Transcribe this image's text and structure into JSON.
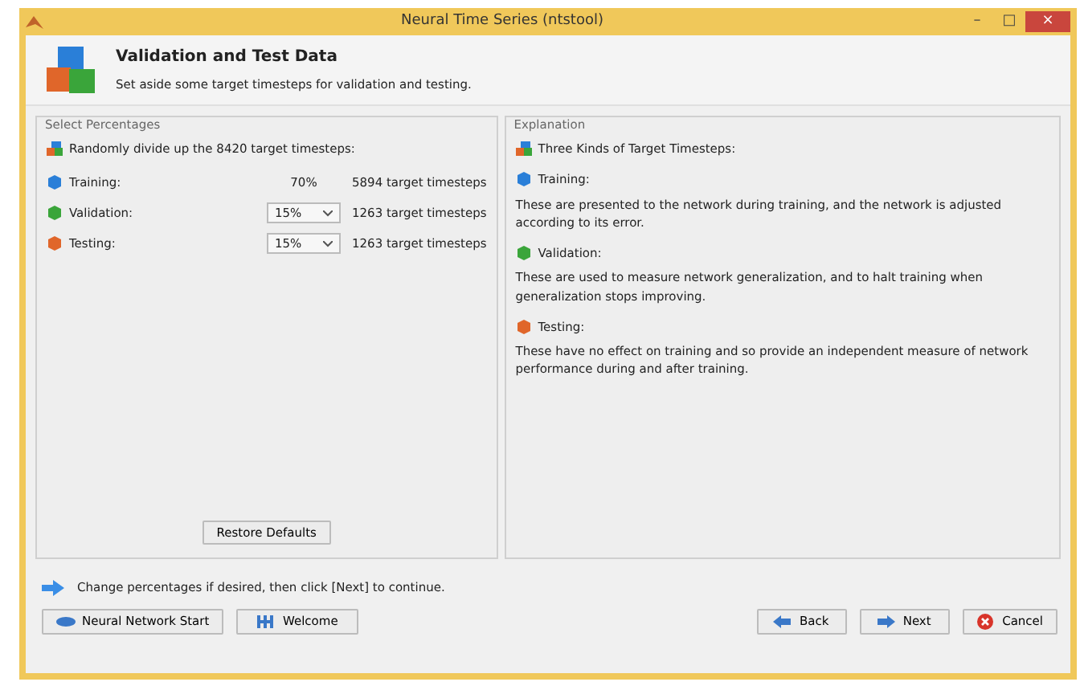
{
  "window": {
    "title": "Neural Time Series (ntstool)",
    "controls": [
      "–",
      "□",
      "×"
    ]
  },
  "header": {
    "title": "Validation and Test Data",
    "subtitle": "Set aside some target timesteps for validation and testing."
  },
  "select_panel": {
    "title": "Select Percentages",
    "intro": "Randomly divide up the 8420 target timesteps:",
    "rows": [
      {
        "label": "Training:",
        "kind": "static",
        "value": "70%",
        "count": "5894 target timesteps",
        "color": "#2a7fd8"
      },
      {
        "label": "Validation:",
        "kind": "select",
        "value": "15%",
        "count": "1263 target timesteps",
        "color": "#3aa53a"
      },
      {
        "label": "Testing:",
        "kind": "select",
        "value": "15%",
        "count": "1263 target timesteps",
        "color": "#e0662a"
      }
    ],
    "restore_button": "Restore Defaults"
  },
  "explanation_panel": {
    "title": "Explanation",
    "intro": "Three Kinds of Target Timesteps:",
    "items": [
      {
        "heading": "Training:",
        "text": "These are presented to the network during training, and the network is adjusted according to its error.",
        "color": "#2a7fd8"
      },
      {
        "heading": "Validation:",
        "text": "These are used to measure network generalization, and to halt training when generalization stops improving.",
        "color": "#3aa53a"
      },
      {
        "heading": "Testing:",
        "text": "These have no effect on training and so provide an independent measure of network performance during and after training.",
        "color": "#e0662a"
      }
    ]
  },
  "hint": "Change percentages if desired, then click [Next] to continue.",
  "buttons_left": [
    {
      "label": "Neural Network Start",
      "kind": "start"
    },
    {
      "label": "Welcome",
      "kind": "welcome"
    }
  ],
  "buttons_right": [
    {
      "label": "Back",
      "kind": "back"
    },
    {
      "label": "Next",
      "kind": "next"
    },
    {
      "label": "Cancel",
      "kind": "cancel"
    }
  ]
}
